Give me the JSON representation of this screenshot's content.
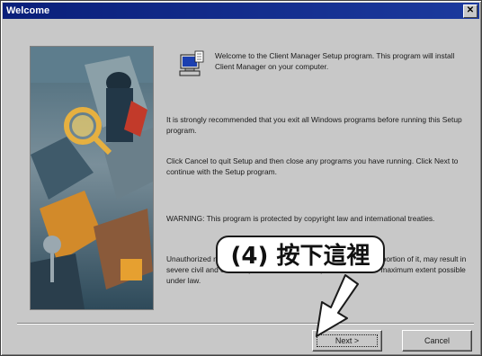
{
  "window": {
    "title": "Welcome",
    "close_label": "✕"
  },
  "body": {
    "intro": "Welcome to the Client Manager Setup program. This program will install Client Manager on your computer.",
    "recommendation": "It is strongly recommended that you exit all Windows programs before running this Setup program.",
    "cancel_note": "Click Cancel to quit Setup and then close any programs you have running. Click Next to continue with the Setup program.",
    "warning": "WARNING: This program is protected by copyright law and international treaties.",
    "unauthorized": "Unauthorized reproduction or distribution of this program, or any portion of it, may result in severe civil and criminal penalties, and will be prosecuted to the maximum extent possible under law."
  },
  "buttons": {
    "next": "Next >",
    "cancel": "Cancel"
  },
  "callout": {
    "text": "(4) 按下這裡"
  },
  "icons": {
    "setup": "computer-setup-icon",
    "close": "close-icon",
    "pointer": "arrow-pointer"
  },
  "colors": {
    "titlebar": "#0a1f7a",
    "face": "#c8c8c8"
  }
}
